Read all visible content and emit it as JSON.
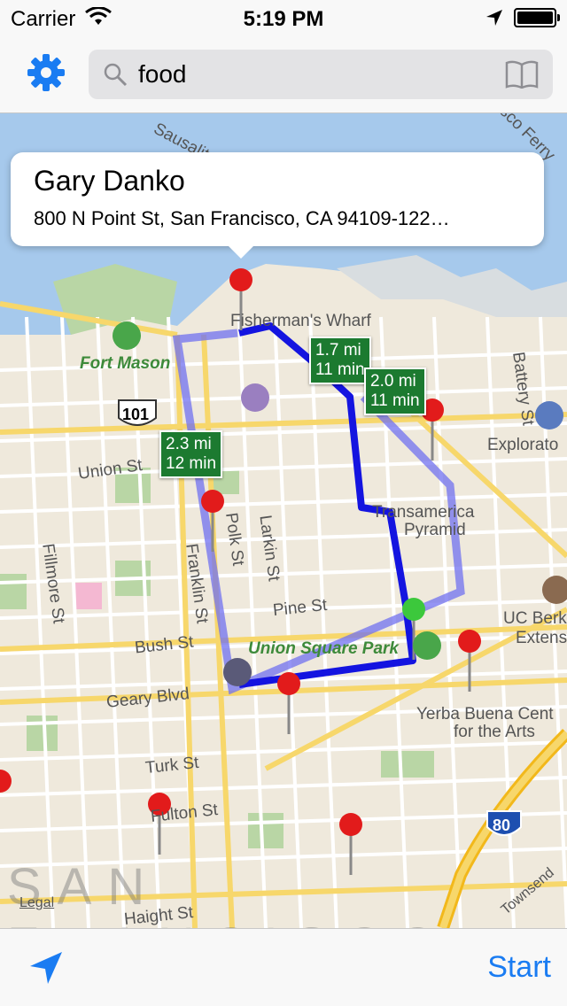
{
  "status_bar": {
    "carrier": "Carrier",
    "time": "5:19 PM"
  },
  "nav": {
    "settings_icon": "gear-icon",
    "search": {
      "value": "food",
      "icon": "magnifier-icon",
      "bookmarks_icon": "book-icon"
    }
  },
  "callout": {
    "title": "Gary Danko",
    "address": "800 N Point St, San Francisco, CA  94109-122…"
  },
  "distance_labels": [
    {
      "distance": "1.7 mi",
      "time": "11 min"
    },
    {
      "distance": "2.0 mi",
      "time": "11 min"
    },
    {
      "distance": "2.3 mi",
      "time": "12 min"
    }
  ],
  "map_labels": {
    "sausalito": "Sausalito",
    "fishermans_wharf": "Fisherman's Wharf",
    "fort_mason": "Fort Mason",
    "hwy_101": "101",
    "union_st": "Union St",
    "franklin_st": "Franklin St",
    "polk_st": "Polk St",
    "larkin_st": "Larkin St",
    "fillmore_st": "Fillmore St",
    "transamerica": "Transamerica",
    "pyramid": "Pyramid",
    "pine_st": "Pine St",
    "bush_st": "Bush St",
    "union_square_park": "Union Square Park",
    "geary_blvd": "Geary Blvd",
    "turk_st": "Turk St",
    "fulton_st": "Fulton St",
    "haight_st": "Haight St",
    "battery_st": "Battery St",
    "exploratorium": "Explorato",
    "uc_berkeley": "UC Berk",
    "uc_extension": "Extens",
    "yerba_buena": "Yerba Buena Cent",
    "for_the_arts": "for the Arts",
    "hwy_80": "80",
    "san_francisco": "SAN FRANCISCO",
    "ferry": "sco Ferry",
    "townsend": "Townsend"
  },
  "legal_label": "Legal",
  "bottom": {
    "location_icon": "location-arrow-icon",
    "start_label": "Start"
  },
  "colors": {
    "accent": "#1a7cf2",
    "route": "#1414e0",
    "route_alt": "#7070f0",
    "distance_bg": "#1c7a30",
    "pin": "#e21b1b"
  }
}
